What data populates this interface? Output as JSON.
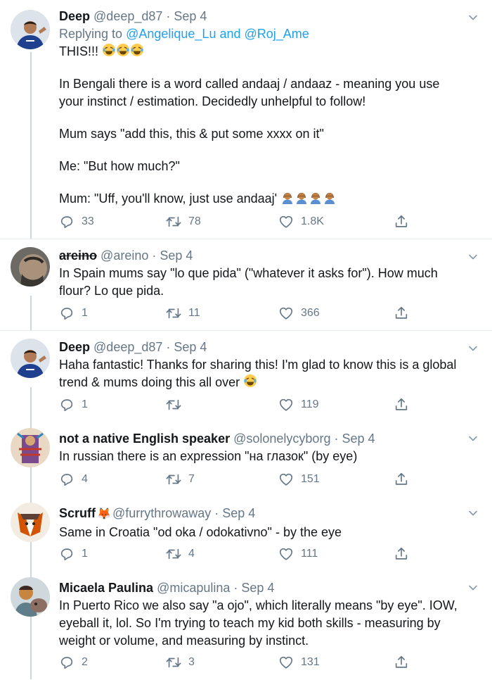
{
  "tweets": [
    {
      "name": "Deep",
      "handle": "@deep_d87",
      "date": "Sep 4",
      "replying_prefix": "Replying to",
      "replying_to": "@Angelique_Lu and @Roj_Ame",
      "lines": [
        "THIS!!!",
        "In Bengali there is a word called andaaj / andaaz - meaning you use your instinct / estimation. Decidedly unhelpful to follow!",
        "Mum says \"add this, this & put some xxxx on it\"",
        "Me: \"But how much?\"",
        "Mum: \"Uff, you'll know, just use andaaj'"
      ],
      "replies": "33",
      "retweets": "78",
      "likes": "1.8K"
    },
    {
      "name": "areino",
      "handle": "@areino",
      "date": "Sep 4",
      "lines": [
        "In Spain mums say \"lo que pida\" (\"whatever it asks for\"). How much flour? Lo que pida."
      ],
      "replies": "1",
      "retweets": "11",
      "likes": "366"
    },
    {
      "name": "Deep",
      "handle": "@deep_d87",
      "date": "Sep 4",
      "lines": [
        "Haha fantastic! Thanks for sharing this! I'm glad to know this is a global trend & mums doing this all over"
      ],
      "replies": "1",
      "retweets": "",
      "likes": "119"
    },
    {
      "name": "not a native English speaker",
      "handle": "@solonelycyborg",
      "date": "Sep 4",
      "lines": [
        "In russian there is an expression \"на глазок\" (by eye)"
      ],
      "replies": "4",
      "retweets": "7",
      "likes": "151"
    },
    {
      "name": "Scruff",
      "handle": "@furrythrowaway",
      "date": "Sep 4",
      "lines": [
        "Same in Croatia \"od oka / odokativno\" - by the eye"
      ],
      "replies": "1",
      "retweets": "4",
      "likes": "111"
    },
    {
      "name": "Micaela Paulina",
      "handle": "@micapulina",
      "date": "Sep 4",
      "lines": [
        "In Puerto Rico we also say \"a ojo\", which literally means \"by eye\". IOW, eyeball it, lol. So I'm trying to teach my kid both skills - measuring by weight or volume, and measuring by instinct."
      ],
      "replies": "2",
      "retweets": "3",
      "likes": "131"
    }
  ],
  "icons": {
    "reply": "reply-icon",
    "retweet": "retweet-icon",
    "like": "heart-icon",
    "share": "share-icon",
    "more": "chevron-down-icon",
    "laugh_emoji": "tears-of-joy-emoji",
    "facepalm_emoji": "facepalm-emoji",
    "fox_emoji": "fox-emoji"
  },
  "colors": {
    "link": "#1da1f2",
    "secondary": "#657786",
    "thread_line": "#ccd6dd"
  }
}
